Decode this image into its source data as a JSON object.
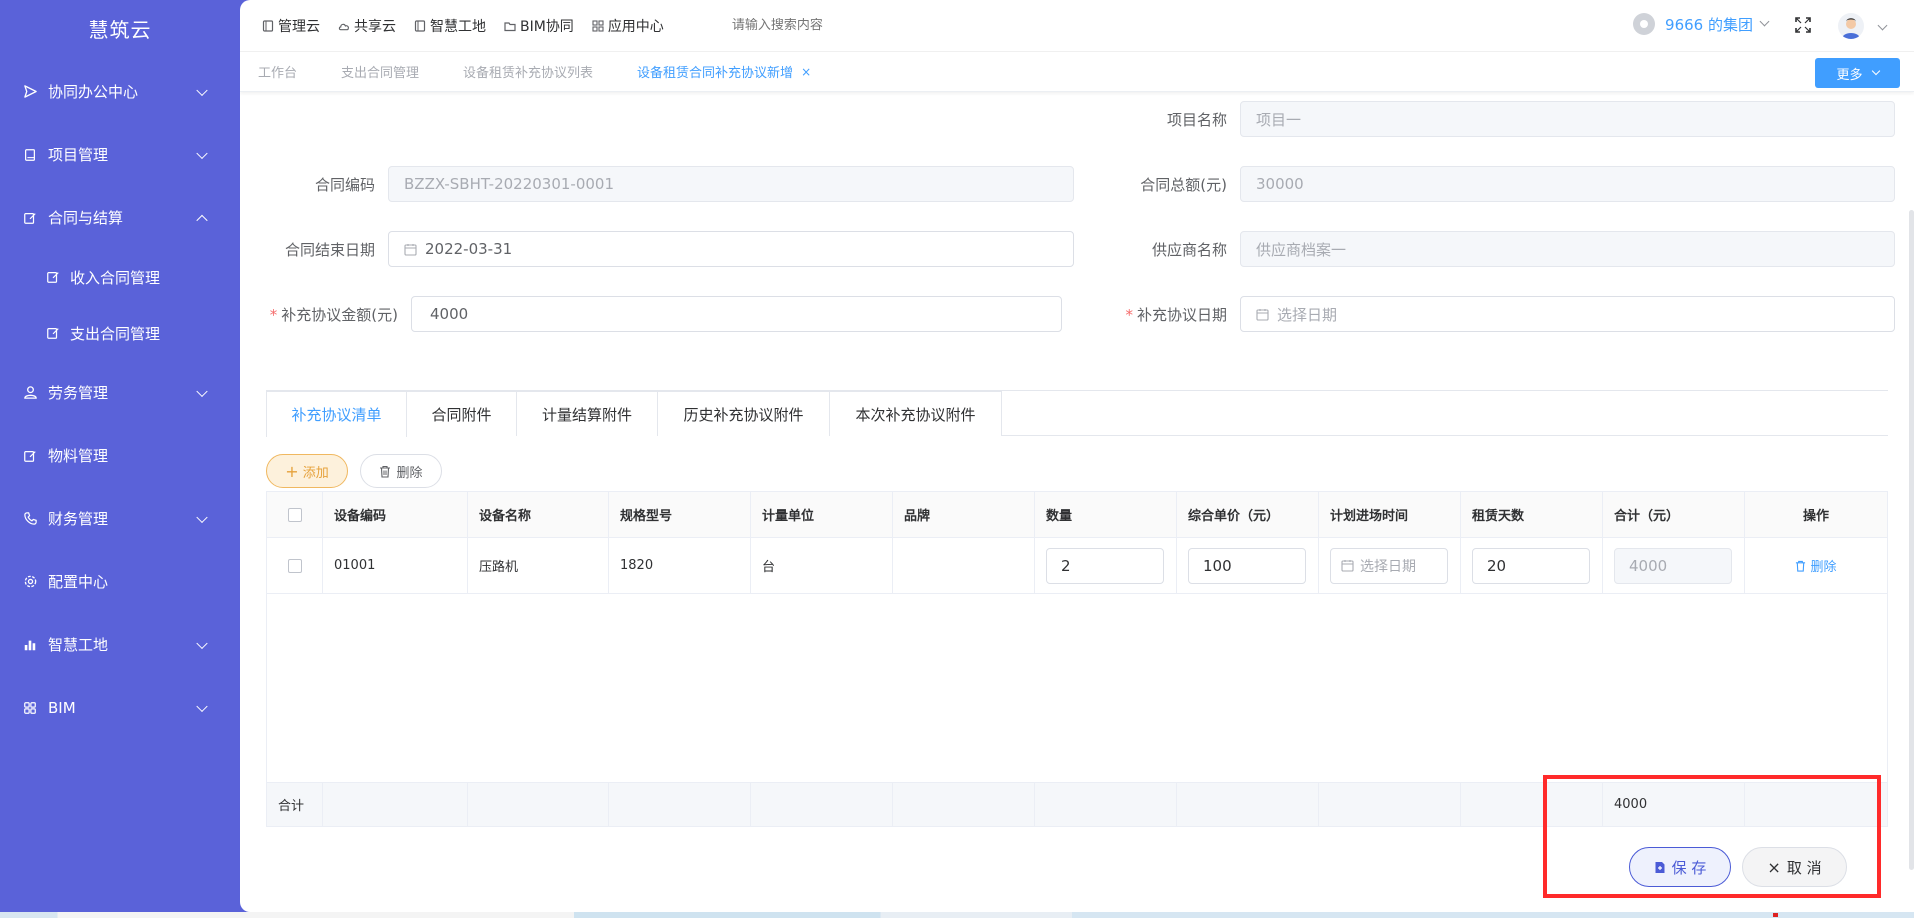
{
  "app": {
    "logo": "慧筑云"
  },
  "sidebar": {
    "items": [
      {
        "label": "协同办公中心",
        "icon": "send-icon",
        "expanded": false,
        "has_children": true
      },
      {
        "label": "项目管理",
        "icon": "book-icon",
        "expanded": false,
        "has_children": true
      },
      {
        "label": "合同与结算",
        "icon": "edit-icon",
        "expanded": true,
        "has_children": true
      },
      {
        "label": "收入合同管理",
        "icon": "edit-icon",
        "sub": true
      },
      {
        "label": "支出合同管理",
        "icon": "edit-icon",
        "sub": true
      },
      {
        "label": "劳务管理",
        "icon": "user-icon",
        "expanded": false,
        "has_children": true
      },
      {
        "label": "物料管理",
        "icon": "edit-icon",
        "has_children": false
      },
      {
        "label": "财务管理",
        "icon": "phone-icon",
        "expanded": false,
        "has_children": true
      },
      {
        "label": "配置中心",
        "icon": "gear-icon",
        "has_children": false
      },
      {
        "label": "智慧工地",
        "icon": "bar-chart-icon",
        "expanded": false,
        "has_children": true
      },
      {
        "label": "BIM",
        "icon": "grid-icon",
        "expanded": false,
        "has_children": true
      }
    ]
  },
  "topnav": {
    "links": [
      {
        "label": "管理云",
        "icon": "doc-icon"
      },
      {
        "label": "共享云",
        "icon": "cloud-icon"
      },
      {
        "label": "智慧工地",
        "icon": "doc-icon"
      },
      {
        "label": "BIM协同",
        "icon": "folder-icon"
      },
      {
        "label": "应用中心",
        "icon": "grid-icon"
      }
    ],
    "search_placeholder": "请输入搜索内容",
    "group": "9666 的集团"
  },
  "tabs": {
    "items": [
      {
        "label": "工作台",
        "active": false
      },
      {
        "label": "支出合同管理",
        "active": false
      },
      {
        "label": "设备租赁补充协议列表",
        "active": false
      },
      {
        "label": "设备租赁合同补充协议新增",
        "active": true,
        "closable": true
      }
    ],
    "close_symbol": "×",
    "more_label": "更多"
  },
  "form": {
    "project_name": {
      "label": "项目名称",
      "value": "项目一"
    },
    "contract_code": {
      "label": "合同编码",
      "value": "BZZX-SBHT-20220301-0001"
    },
    "contract_total": {
      "label": "合同总额(元)",
      "value": "30000"
    },
    "contract_end_date": {
      "label": "合同结束日期",
      "value": "2022-03-31"
    },
    "supplier_name": {
      "label": "供应商名称",
      "value": "供应商档案一"
    },
    "supp_amount": {
      "label": "补充协议金额(元)",
      "value": "4000",
      "required": true
    },
    "supp_date": {
      "label": "补充协议日期",
      "placeholder": "选择日期",
      "required": true
    },
    "required_mark": "*"
  },
  "subtabs": [
    {
      "label": "补充协议清单",
      "active": true
    },
    {
      "label": "合同附件"
    },
    {
      "label": "计量结算附件"
    },
    {
      "label": "历史补充协议附件"
    },
    {
      "label": "本次补充协议附件"
    }
  ],
  "toolbar": {
    "add_label": "添加",
    "delete_label": "删除",
    "add_symbol": "+"
  },
  "table": {
    "columns": [
      "设备编码",
      "设备名称",
      "规格型号",
      "计量单位",
      "品牌",
      "数量",
      "综合单价（元）",
      "计划进场时间",
      "租赁天数",
      "合计（元）",
      "操作"
    ],
    "rows": [
      {
        "code": "01001",
        "name": "压路机",
        "spec": "1820",
        "unit": "台",
        "brand": "",
        "qty": "2",
        "price": "100",
        "entry_placeholder": "选择日期",
        "days": "20",
        "total": "4000",
        "op": "删除"
      }
    ],
    "footer": {
      "label": "合计",
      "total": "4000"
    }
  },
  "actions": {
    "save_label": "保 存",
    "cancel_label": "取 消",
    "cancel_symbol": "×"
  },
  "colors": {
    "sidebar": "#5a62d9",
    "primary": "#409eff",
    "highlight": "#ff2a2a"
  }
}
